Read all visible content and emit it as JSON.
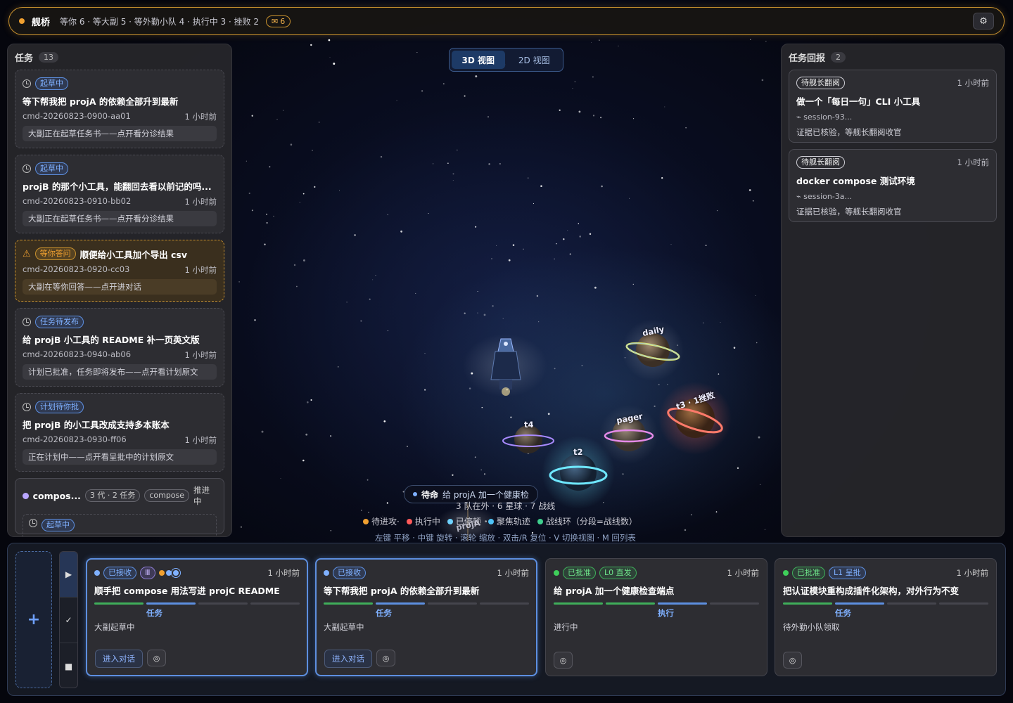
{
  "topbar": {
    "title": "舰桥",
    "summary": "等你 6 · 等大副 5 · 等外勤小队 4 · 执行中 3 · 挫败 2",
    "mail_count": "6",
    "mail_icon": "envelope-icon",
    "settings_icon": "gear-icon"
  },
  "left": {
    "title": "任务",
    "count": "13",
    "tasks": [
      {
        "status": "起草中",
        "title": "等下帮我把 projA 的依赖全部升到最新",
        "id": "cmd-20260823-0900-aa01",
        "time": "1 小时前",
        "note": "大副正在起草任务书——点开看分诊结果"
      },
      {
        "status": "起草中",
        "title": "projB 的那个小工具，能翻回去看以前记的吗...",
        "id": "cmd-20260823-0910-bb02",
        "time": "1 小时前",
        "note": "大副正在起草任务书——点开看分诊结果"
      },
      {
        "status": "等你答问",
        "title": "顺便给小工具加个导出 csv",
        "id": "cmd-20260823-0920-cc03",
        "time": "1 小时前",
        "note": "大副在等你回答——点开进对话"
      },
      {
        "status": "任务待发布",
        "title": "给 projB 小工具的 README 补一页英文版",
        "id": "cmd-20260823-0940-ab06",
        "time": "1 小时前",
        "note": "计划已批准，任务即将发布——点开看计划原文"
      },
      {
        "status": "计划待你批",
        "title": "把 projB 的小工具改成支持多本账本",
        "id": "cmd-20260823-0930-ff06",
        "time": "1 小时前",
        "note": "正在计划中——点开看呈批中的计划原文"
      }
    ],
    "group": {
      "name": "compos...",
      "gen": "3 代 · 2 任务",
      "tag": "compose",
      "status": "推进中",
      "sub_status": "起草中"
    }
  },
  "right": {
    "title": "任务回报",
    "count": "2",
    "reports": [
      {
        "status": "待舰长翻阅",
        "time": "1 小时前",
        "title": "做一个「每日一句」CLI 小工具",
        "session": "⌁ session-93...",
        "note": "证据已核验，等舰长翻阅收官"
      },
      {
        "status": "待舰长翻阅",
        "time": "1 小时前",
        "title": "docker compose 测试环境",
        "session": "⌁ session-3a...",
        "note": "证据已核验，等舰长翻阅收官"
      }
    ]
  },
  "view": {
    "mode_3d": "3D 视图",
    "mode_2d": "2D 视图"
  },
  "scene": {
    "mission_label": "待命",
    "mission_text": "给 projA 加一个健康检",
    "stats": "3 队在外 · 6 星球 · 7 战线",
    "legend": [
      {
        "label": "待进攻·",
        "color": "#f0a030"
      },
      {
        "label": "执行中",
        "color": "#ff5a5a"
      },
      {
        "label": "已停顿",
        "color": "#6fd3ff"
      },
      {
        "label": "聚焦轨迹",
        "color": "#4fc3f7"
      },
      {
        "label": "战线环（分段=战线数）",
        "color": "#3fcf8e"
      }
    ],
    "hint": "左键 平移 · 中键 旋转 · 滚轮 缩放 · 双击/R 复位 · V 切换视图 · M 回列表",
    "planets": [
      {
        "name": "daily",
        "color": "#e8e8c0"
      },
      {
        "name": "t3 · 1挫败",
        "color": "#ffb0a8"
      },
      {
        "name": "pager",
        "color": "#e0c8ff"
      },
      {
        "name": "t4",
        "color": "#e6e6f0"
      },
      {
        "name": "t2",
        "color": "#c8f0ff"
      },
      {
        "name": "projA",
        "color": "#c8d8ff"
      }
    ]
  },
  "dock": {
    "add_icon": "plus-icon",
    "controls": [
      {
        "icon": "play-icon",
        "glyph": "▶"
      },
      {
        "icon": "check-icon",
        "glyph": "✓"
      },
      {
        "icon": "stop-icon",
        "glyph": "■"
      }
    ],
    "cards": [
      {
        "status": "已接收",
        "extra": "Ⅲ",
        "time": "1 小时前",
        "title": "顺手把 compose 用法写进 projC README",
        "stage": "任务",
        "state": "大副起草中",
        "chat": "进入对话",
        "progress_done": 1,
        "progress_current": 2,
        "progress_total": 4
      },
      {
        "status": "已接收",
        "extra": "",
        "time": "1 小时前",
        "title": "等下帮我把 projA 的依赖全部升到最新",
        "stage": "任务",
        "state": "大副起草中",
        "chat": "进入对话",
        "progress_done": 1,
        "progress_current": 2,
        "progress_total": 4
      },
      {
        "status": "已批准",
        "extra": "L0 直发",
        "time": "1 小时前",
        "title": "给 projA 加一个健康检查端点",
        "stage": "执行",
        "state": "进行中",
        "chat": "",
        "progress_done": 2,
        "progress_current": 3,
        "progress_total": 4
      },
      {
        "status": "已批准",
        "extra": "L1 呈批",
        "time": "1 小时前",
        "title": "把认证模块重构成插件化架构，对外行为不变",
        "stage": "任务",
        "state": "待外勤小队领取",
        "chat": "",
        "progress_done": 1,
        "progress_current": 2,
        "progress_total": 4
      }
    ]
  }
}
